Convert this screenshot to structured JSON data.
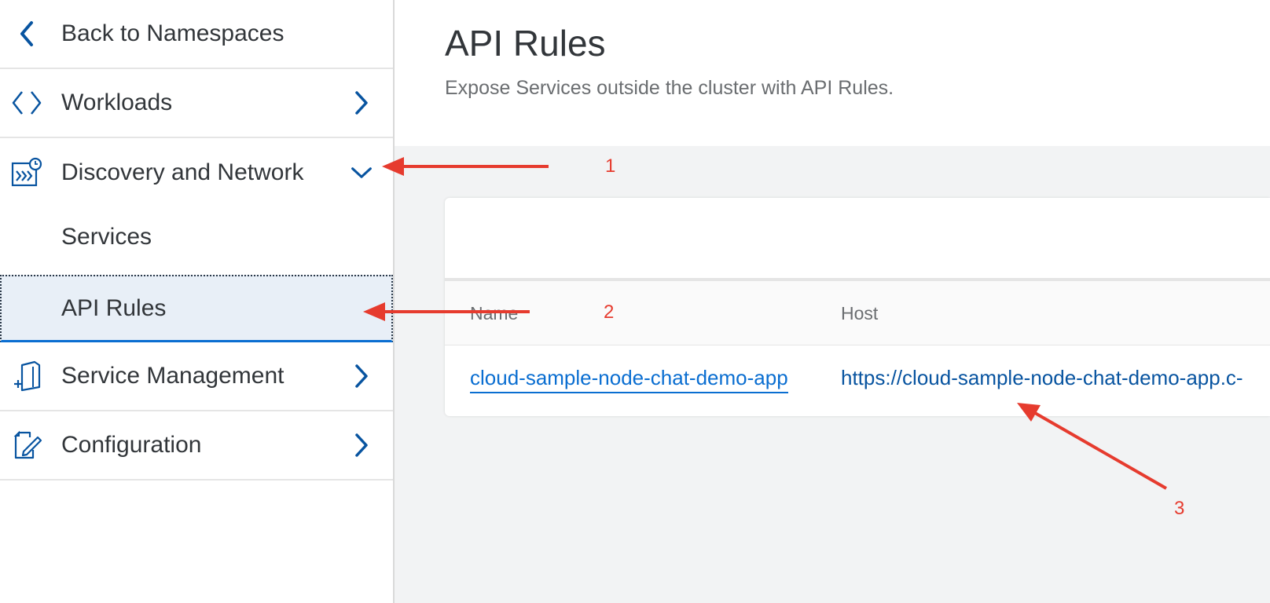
{
  "sidebar": {
    "back": {
      "label": "Back to Namespaces",
      "icon": "chevron-left-icon"
    },
    "items": [
      {
        "label": "Workloads",
        "icon": "code-brackets-icon",
        "expanded": false
      },
      {
        "label": "Discovery and Network",
        "icon": "discovery-network-icon",
        "expanded": true,
        "children": [
          {
            "label": "Services",
            "selected": false
          },
          {
            "label": "API Rules",
            "selected": true
          }
        ]
      },
      {
        "label": "Service Management",
        "icon": "service-management-icon",
        "expanded": false
      },
      {
        "label": "Configuration",
        "icon": "configuration-icon",
        "expanded": false
      }
    ]
  },
  "header": {
    "title": "API Rules",
    "subtitle": "Expose Services outside the cluster with API Rules."
  },
  "table": {
    "columns": [
      "Name",
      "Host"
    ],
    "rows": [
      {
        "name": "cloud-sample-node-chat-demo-app",
        "host": "https://cloud-sample-node-chat-demo-app.c-"
      }
    ]
  },
  "annotations": [
    "1",
    "2",
    "3"
  ],
  "colors": {
    "accent": "#0a6ed1",
    "icon": "#0854a0",
    "annotation": "#e63b2e",
    "selected_bg": "#e8eff7"
  }
}
